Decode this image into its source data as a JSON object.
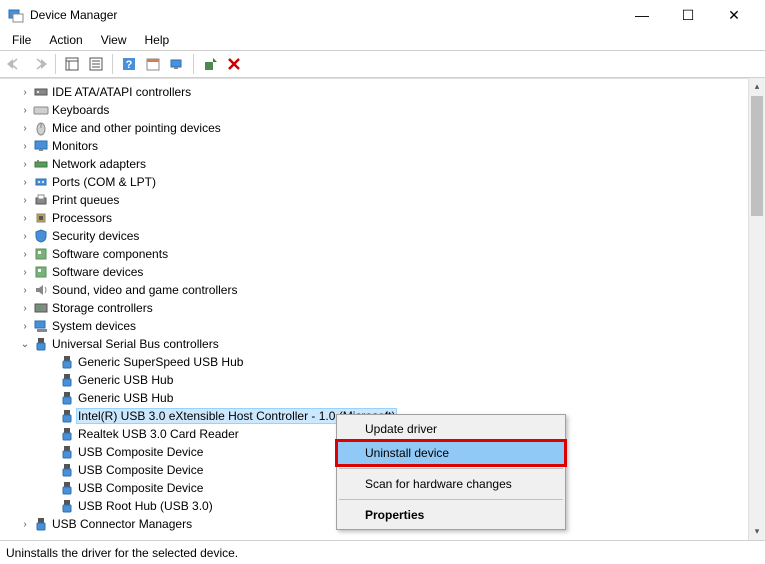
{
  "window": {
    "title": "Device Manager"
  },
  "menu": {
    "file": "File",
    "action": "Action",
    "view": "View",
    "help": "Help"
  },
  "tree": {
    "items": [
      {
        "label": "IDE ATA/ATAPI controllers",
        "icon": "ide"
      },
      {
        "label": "Keyboards",
        "icon": "keyboard"
      },
      {
        "label": "Mice and other pointing devices",
        "icon": "mouse"
      },
      {
        "label": "Monitors",
        "icon": "monitor"
      },
      {
        "label": "Network adapters",
        "icon": "network"
      },
      {
        "label": "Ports (COM & LPT)",
        "icon": "port"
      },
      {
        "label": "Print queues",
        "icon": "printer"
      },
      {
        "label": "Processors",
        "icon": "cpu"
      },
      {
        "label": "Security devices",
        "icon": "security"
      },
      {
        "label": "Software components",
        "icon": "software"
      },
      {
        "label": "Software devices",
        "icon": "software"
      },
      {
        "label": "Sound, video and game controllers",
        "icon": "sound"
      },
      {
        "label": "Storage controllers",
        "icon": "storage"
      },
      {
        "label": "System devices",
        "icon": "system"
      },
      {
        "label": "Universal Serial Bus controllers",
        "icon": "usb",
        "expanded": true,
        "children": [
          {
            "label": "Generic SuperSpeed USB Hub",
            "icon": "usb"
          },
          {
            "label": "Generic USB Hub",
            "icon": "usb"
          },
          {
            "label": "Generic USB Hub",
            "icon": "usb"
          },
          {
            "label": "Intel(R) USB 3.0 eXtensible Host Controller - 1.0 (Microsoft)",
            "icon": "usb",
            "selected": true
          },
          {
            "label": "Realtek USB 3.0 Card Reader",
            "icon": "usb"
          },
          {
            "label": "USB Composite Device",
            "icon": "usb"
          },
          {
            "label": "USB Composite Device",
            "icon": "usb"
          },
          {
            "label": "USB Composite Device",
            "icon": "usb"
          },
          {
            "label": "USB Root Hub (USB 3.0)",
            "icon": "usb"
          }
        ]
      },
      {
        "label": "USB Connector Managers",
        "icon": "usb"
      }
    ]
  },
  "context_menu": {
    "update_driver": "Update driver",
    "uninstall": "Uninstall device",
    "scan": "Scan for hardware changes",
    "properties": "Properties"
  },
  "status": "Uninstalls the driver for the selected device."
}
